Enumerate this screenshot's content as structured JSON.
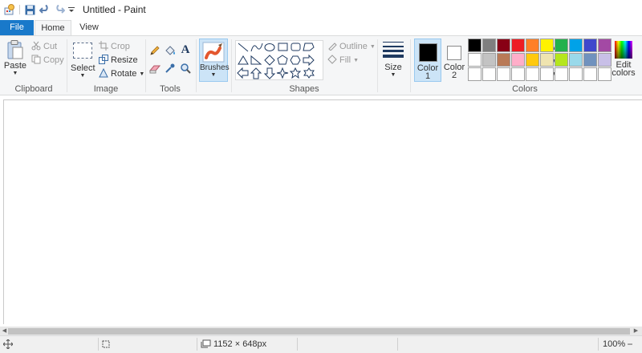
{
  "window": {
    "title": "Untitled - Paint"
  },
  "quick_access": {
    "icons": [
      "paint-app-icon",
      "save-icon",
      "undo-icon",
      "redo-icon",
      "customize-dropdown-icon"
    ]
  },
  "tabs": [
    {
      "label": "File"
    },
    {
      "label": "Home"
    },
    {
      "label": "View"
    }
  ],
  "clipboard": {
    "paste_label": "Paste",
    "cut_label": "Cut",
    "copy_label": "Copy",
    "group_label": "Clipboard"
  },
  "image": {
    "select_label": "Select",
    "crop_label": "Crop",
    "resize_label": "Resize",
    "rotate_label": "Rotate",
    "group_label": "Image"
  },
  "tools": {
    "group_label": "Tools",
    "items": [
      "pencil-icon",
      "fill-icon",
      "text-icon",
      "eraser-icon",
      "color-picker-icon",
      "magnifier-icon"
    ]
  },
  "brushes": {
    "label": "Brushes"
  },
  "shapes": {
    "group_label": "Shapes",
    "outline_label": "Outline",
    "fill_label": "Fill",
    "items": [
      "line",
      "curve",
      "oval",
      "rectangle",
      "rounded-rectangle",
      "polygon",
      "triangle",
      "right-triangle",
      "diamond",
      "pentagon",
      "hexagon",
      "right-arrow",
      "left-arrow",
      "up-arrow",
      "down-arrow",
      "four-point-star",
      "five-point-star",
      "six-point-star"
    ]
  },
  "size": {
    "label": "Size"
  },
  "colors": {
    "group_label": "Colors",
    "color1_label_line1": "Color",
    "color1_label_line2": "1",
    "color2_label_line1": "Color",
    "color2_label_line2": "2",
    "edit_label_line1": "Edit",
    "edit_label_line2": "colors",
    "color1": "#000000",
    "color2": "#ffffff",
    "palette_row1": [
      "#000000",
      "#7f7f7f",
      "#880015",
      "#ed1c24",
      "#ff7f27",
      "#fff200",
      "#22b14c",
      "#00a2e8",
      "#3f48cc",
      "#a349a4"
    ],
    "palette_row2": [
      "#ffffff",
      "#c3c3c3",
      "#b97a57",
      "#ffaec9",
      "#ffc90e",
      "#efe4b0",
      "#b5e61d",
      "#99d9ea",
      "#7092be",
      "#c8bfe7"
    ],
    "palette_row3": [
      "#ffffff",
      "#ffffff",
      "#ffffff",
      "#ffffff",
      "#ffffff",
      "#ffffff",
      "#ffffff",
      "#ffffff",
      "#ffffff",
      "#ffffff"
    ]
  },
  "status": {
    "dimensions": "1152 × 648px",
    "zoom": "100%"
  }
}
